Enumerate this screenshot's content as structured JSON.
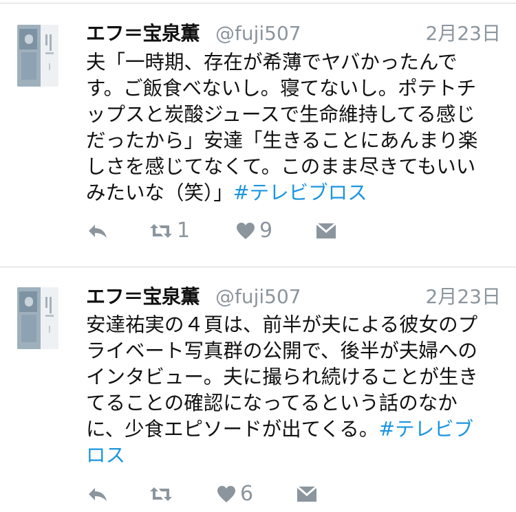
{
  "tweets": [
    {
      "display_name": "エフ＝宝泉薫",
      "handle": "@fuji507",
      "timestamp": "2月23日",
      "lines": [
        "夫「一時期、存在が希薄でヤバかったんで",
        "す。ご飯食べないし。寝てないし。ポテトチ",
        "ップスと炭酸ジュースで生命維持してる感じ",
        "だったから」安達「生きることにあんまり楽",
        "しさを感じてなくて。このまま尽きてもいい"
      ],
      "last_line_text": "みたいな（笑）」",
      "hashtag_parts": [
        "#テレビブロス"
      ],
      "retweet_count": "1",
      "like_count": "9"
    },
    {
      "display_name": "エフ＝宝泉薫",
      "handle": "@fuji507",
      "timestamp": "2月23日",
      "lines": [
        "安達祐実の４頁は、前半が夫による彼女のプ",
        "ライベート写真群の公開で、後半が夫婦への",
        "インタビュー。夫に撮られ続けることが生き",
        "てることの確認になってるという話のなか"
      ],
      "last_line_text": "に、少食エピソードが出てくる。",
      "hashtag_parts": [
        "#テレビブ",
        "ロス"
      ],
      "retweet_count": "",
      "like_count": "6"
    }
  ],
  "icons": {
    "reply": "reply-icon",
    "retweet": "retweet-icon",
    "like": "heart-icon",
    "message": "direct-message-icon"
  },
  "colors": {
    "hashtag": "#1b95e0",
    "meta": "#8b959e",
    "divider": "#d6d6d6"
  }
}
